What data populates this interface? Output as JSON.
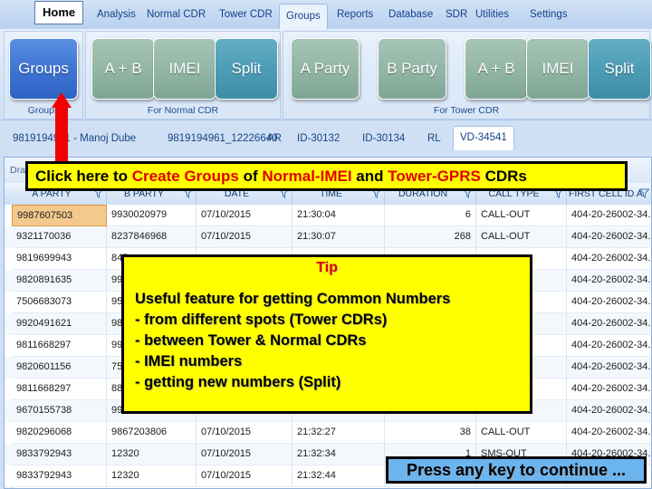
{
  "app": {
    "accent_blue": "#3c72d1",
    "accent_green": "#7fa695",
    "accent_teal": "#4d9db7",
    "highlight_yellow": "#ffff00",
    "alert_red": "#e00000",
    "selection_orange": "#f5c98e"
  },
  "ribbon": {
    "home_label": "Home",
    "tabs": [
      {
        "label": "Analysis",
        "active": false
      },
      {
        "label": "Normal CDR",
        "active": false
      },
      {
        "label": "Tower CDR",
        "active": false
      },
      {
        "label": "Groups",
        "active": true
      },
      {
        "label": "Reports",
        "active": false
      },
      {
        "label": "Database",
        "active": false
      },
      {
        "label": "SDR",
        "active": false
      },
      {
        "label": "Utilities",
        "active": false
      },
      {
        "label": "Settings",
        "active": false
      }
    ],
    "groups": [
      {
        "label": "Groups",
        "buttons": [
          {
            "label": "Groups",
            "style": "blue"
          }
        ]
      },
      {
        "label": "For Normal CDR",
        "buttons": [
          {
            "label": "A + B",
            "style": "green"
          },
          {
            "label": "IMEI",
            "style": "green"
          },
          {
            "label": "Split",
            "style": "teal"
          }
        ]
      },
      {
        "label": "For Tower CDR",
        "buttons": [
          {
            "label": "A Party",
            "style": "green"
          },
          {
            "label": "B Party",
            "style": "green"
          },
          {
            "label": "A + B",
            "style": "green"
          },
          {
            "label": "IMEI",
            "style": "green"
          },
          {
            "label": "Split",
            "style": "teal"
          }
        ]
      }
    ]
  },
  "breadcrumbs": [
    {
      "label": "9819194961 - Manoj Dube",
      "selected": false
    },
    {
      "label": "9819194961_12226640",
      "selected": false
    },
    {
      "label": "AR",
      "selected": false
    },
    {
      "label": "ID-30132",
      "selected": false
    },
    {
      "label": "ID-30134",
      "selected": false
    },
    {
      "label": "RL",
      "selected": false
    },
    {
      "label": "VD-34541",
      "selected": true
    }
  ],
  "grid": {
    "group_panel_hint": "Drag a column header here to group by that column",
    "columns": [
      {
        "label": "A PARTY"
      },
      {
        "label": "B PARTY"
      },
      {
        "label": "DATE"
      },
      {
        "label": "TIME"
      },
      {
        "label": "DURATION"
      },
      {
        "label": "CALL TYPE"
      },
      {
        "label": "FIRST CELL ID A"
      }
    ],
    "rows": [
      {
        "a_party": "9987607503",
        "b_party": "9930020979",
        "date": "07/10/2015",
        "time": "21:30:04",
        "duration": "6",
        "call_type": "CALL-OUT",
        "first_cell": "404-20-26002-34...",
        "selected": true
      },
      {
        "a_party": "9321170036",
        "b_party": "8237846968",
        "date": "07/10/2015",
        "time": "21:30:07",
        "duration": "268",
        "call_type": "CALL-OUT",
        "first_cell": "404-20-26002-34...",
        "selected": false
      },
      {
        "a_party": "9819699943",
        "b_party": "845",
        "date": "",
        "time": "",
        "duration": "",
        "call_type": "",
        "first_cell": "404-20-26002-34...",
        "selected": false
      },
      {
        "a_party": "9820891635",
        "b_party": "993",
        "date": "",
        "time": "",
        "duration": "",
        "call_type": "",
        "first_cell": "404-20-26002-34...",
        "selected": false
      },
      {
        "a_party": "7506683073",
        "b_party": "959",
        "date": "",
        "time": "",
        "duration": "",
        "call_type": "",
        "first_cell": "404-20-26002-34...",
        "selected": false
      },
      {
        "a_party": "9920491621",
        "b_party": "983",
        "date": "",
        "time": "",
        "duration": "",
        "call_type": "",
        "first_cell": "404-20-26002-34...",
        "selected": false
      },
      {
        "a_party": "9811668297",
        "b_party": "999",
        "date": "",
        "time": "",
        "duration": "",
        "call_type": "",
        "first_cell": "404-20-26002-34...",
        "selected": false
      },
      {
        "a_party": "9820601156",
        "b_party": "750",
        "date": "",
        "time": "",
        "duration": "",
        "call_type": "",
        "first_cell": "404-20-26002-34...",
        "selected": false
      },
      {
        "a_party": "9811668297",
        "b_party": "887",
        "date": "",
        "time": "",
        "duration": "",
        "call_type": "",
        "first_cell": "404-20-26002-34...",
        "selected": false
      },
      {
        "a_party": "9670155738",
        "b_party": "991",
        "date": "",
        "time": "",
        "duration": "",
        "call_type": "",
        "first_cell": "404-20-26002-34...",
        "selected": false
      },
      {
        "a_party": "9820296068",
        "b_party": "9867203806",
        "date": "07/10/2015",
        "time": "21:32:27",
        "duration": "38",
        "call_type": "CALL-OUT",
        "first_cell": "404-20-26002-34...",
        "selected": false
      },
      {
        "a_party": "9833792943",
        "b_party": "12320",
        "date": "07/10/2015",
        "time": "21:32:34",
        "duration": "1",
        "call_type": "SMS-OUT",
        "first_cell": "404-20-26002-34...",
        "selected": false
      },
      {
        "a_party": "9833792943",
        "b_party": "12320",
        "date": "07/10/2015",
        "time": "21:32:44",
        "duration": "",
        "call_type": "",
        "first_cell": "",
        "selected": false
      }
    ]
  },
  "callout": {
    "part1": "Click here to ",
    "part2": "Create Groups",
    "part3": " of ",
    "part4": "Normal-IMEI",
    "part5": " and ",
    "part6": "Tower-GPRS",
    "part7": " CDRs"
  },
  "tip": {
    "title": "Tip",
    "line1": "Useful feature for getting Common Numbers",
    "line2": "- from different spots (Tower CDRs)",
    "line3": "- between Tower & Normal CDRs",
    "line4": "- IMEI numbers",
    "line5": "- getting new numbers (Split)"
  },
  "footer": {
    "press_key": "Press any key to continue ..."
  }
}
